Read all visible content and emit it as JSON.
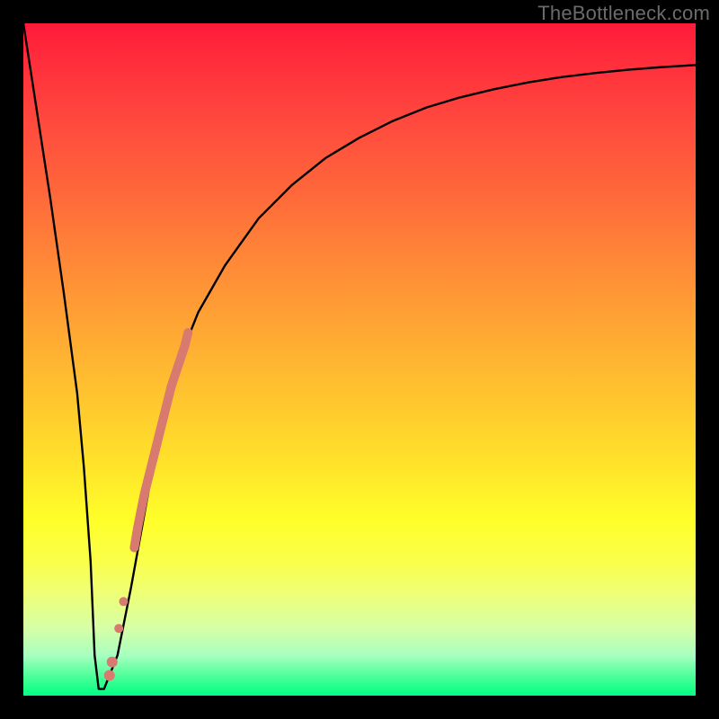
{
  "watermark": "TheBottleneck.com",
  "chart_data": {
    "type": "line",
    "title": "",
    "xlabel": "",
    "ylabel": "",
    "xlim": [
      0,
      100
    ],
    "ylim": [
      0,
      100
    ],
    "grid": false,
    "legend": false,
    "series": [
      {
        "name": "curve",
        "color": "#000000",
        "x": [
          0,
          2,
          4,
          6,
          8,
          9,
          10,
          10.6,
          11.2,
          12,
          14,
          16,
          18,
          20,
          22,
          24,
          26,
          30,
          35,
          40,
          45,
          50,
          55,
          60,
          65,
          70,
          75,
          80,
          85,
          90,
          95,
          100
        ],
        "y": [
          100,
          87,
          74,
          60,
          45,
          34,
          20,
          6,
          1,
          1,
          6,
          16,
          27,
          38,
          46,
          52,
          57,
          64,
          71,
          76,
          80,
          83,
          85.5,
          87.5,
          89,
          90.2,
          91.2,
          92,
          92.6,
          93.1,
          93.5,
          93.8
        ]
      }
    ],
    "highlights": [
      {
        "name": "thick-segment",
        "color": "#d87a70",
        "width": 10,
        "x": [
          16.5,
          17,
          18,
          19,
          20,
          21,
          22,
          23,
          24,
          24.5
        ],
        "y": [
          22,
          25,
          30,
          34,
          38,
          42,
          46,
          49,
          52,
          54
        ]
      },
      {
        "name": "dot-1",
        "color": "#d87a70",
        "r": 5,
        "cx": 14.2,
        "cy": 10
      },
      {
        "name": "dot-2",
        "color": "#d87a70",
        "r": 5,
        "cx": 14.9,
        "cy": 14
      },
      {
        "name": "dot-3",
        "color": "#d87a70",
        "r": 6,
        "cx": 12.8,
        "cy": 3
      },
      {
        "name": "dot-4",
        "color": "#d87a70",
        "r": 6,
        "cx": 13.2,
        "cy": 5
      }
    ]
  }
}
